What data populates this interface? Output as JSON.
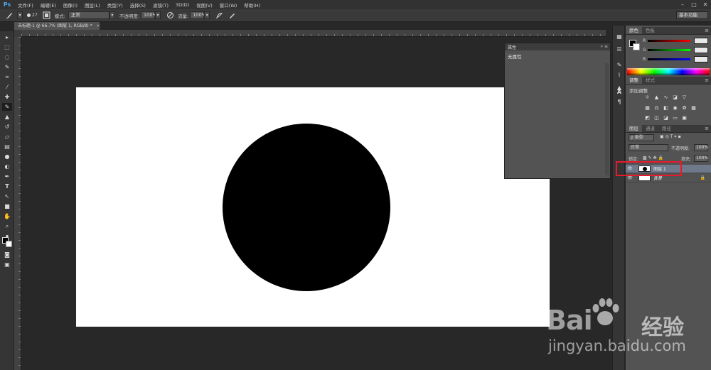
{
  "app": {
    "logo": "Ps"
  },
  "menubar": {
    "items": [
      "文件(F)",
      "编辑(E)",
      "图像(I)",
      "图层(L)",
      "类型(Y)",
      "选择(S)",
      "滤镜(T)",
      "3D(D)",
      "视图(V)",
      "窗口(W)",
      "帮助(H)"
    ],
    "minimize": "–",
    "maximize": "□",
    "close": "✕"
  },
  "options": {
    "brush_size": "27",
    "mode_label": "模式:",
    "mode_value": "正常",
    "opacity_label": "不透明度:",
    "opacity_value": "100%",
    "flow_label": "流量:",
    "flow_value": "100%",
    "workspace": "基本功能"
  },
  "document": {
    "tab_title": "未标题-1 @ 66.7% (图层 1, RGB/8) *",
    "tab_close": "×"
  },
  "properties_panel": {
    "title": "属性",
    "content": "无属性",
    "controls": "» ≡"
  },
  "color_panel": {
    "tab_active": "颜色",
    "tab_inactive": "色板",
    "r_label": "R",
    "g_label": "G",
    "b_label": "B",
    "r_value": "",
    "g_value": "",
    "b_value": ""
  },
  "adjustments_panel": {
    "tab_active": "调整",
    "tab_inactive": "样式",
    "title": "添加调整"
  },
  "layers_panel": {
    "tab_active": "图层",
    "tab_channels": "通道",
    "tab_paths": "路径",
    "filter_label": "ρ 类型",
    "blend_mode": "正常",
    "opacity_label": "不透明度:",
    "opacity_value": "100%",
    "lock_label": "锁定:",
    "fill_label": "填充:",
    "fill_value": "100%",
    "layers": [
      {
        "name": "图层 1",
        "selected": true
      },
      {
        "name": "背景",
        "selected": false
      }
    ]
  },
  "watermark": {
    "brand": "Bai",
    "brand_suffix": "经验",
    "url": "jingyan.baidu.com"
  },
  "colors": {
    "accent_highlight": "#e8192c",
    "panel_bg": "#535353",
    "canvas_bg": "#282828"
  }
}
